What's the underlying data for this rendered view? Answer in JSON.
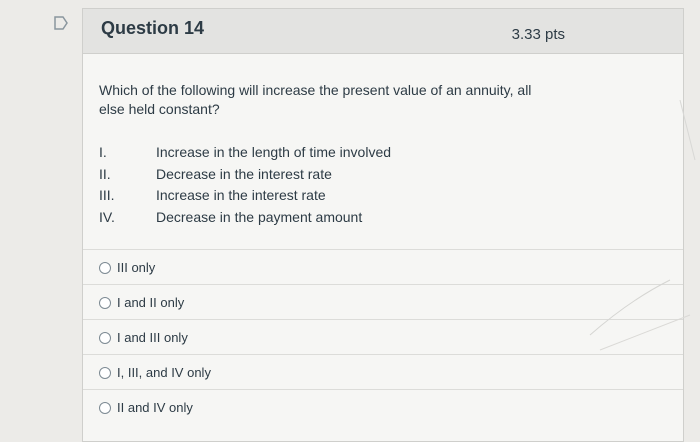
{
  "question": {
    "title": "Question 14",
    "points": "3.33 pts",
    "text": "Which of the following will increase the present value of an annuity, all else held constant?",
    "statements": [
      {
        "num": "I.",
        "text": "Increase in the length of time involved"
      },
      {
        "num": "II.",
        "text": "Decrease in the interest rate"
      },
      {
        "num": "III.",
        "text": "Increase in the interest rate"
      },
      {
        "num": "IV.",
        "text": "Decrease in the payment amount"
      }
    ],
    "answers": [
      {
        "label": "III only"
      },
      {
        "label": "I and II only"
      },
      {
        "label": "I and III only"
      },
      {
        "label": "I, III, and IV only"
      },
      {
        "label": "II and IV only"
      }
    ]
  },
  "icons": {
    "flag": "bookmark-flag-icon",
    "radio": "radio-unchecked-icon"
  },
  "colors": {
    "text": "#2d3b45",
    "header_bg": "#e3e3e1",
    "card_bg": "#f6f6f4",
    "page_bg": "#ecebe8"
  }
}
